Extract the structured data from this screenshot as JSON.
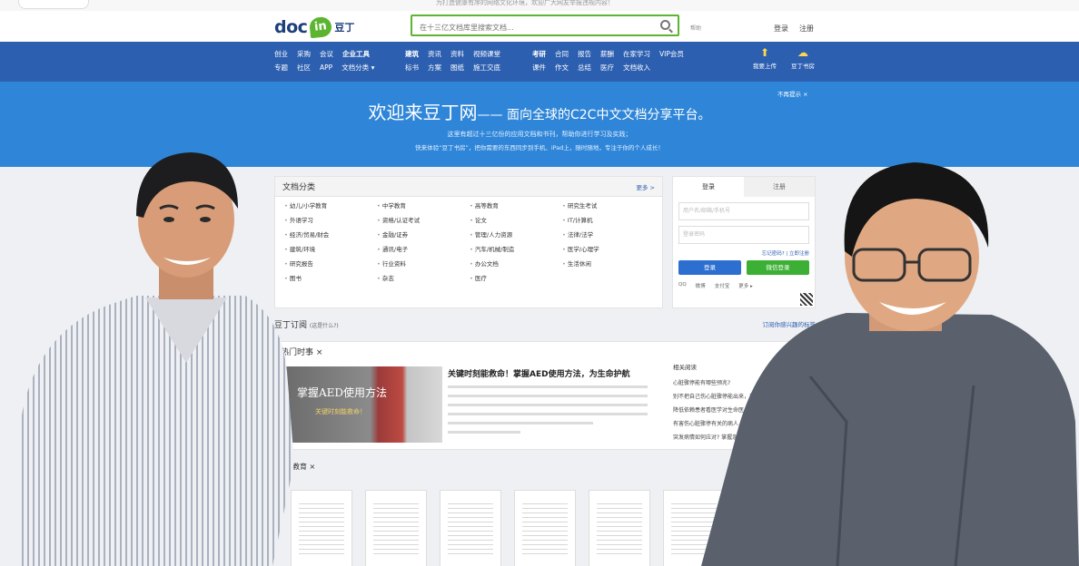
{
  "top_notice": "为打造健康有序的网络文化环境，欢迎广大网友举报违规内容！",
  "header": {
    "logo_doc": "doc",
    "logo_in": "in",
    "logo_cn": "豆丁",
    "search_placeholder": "在十三亿文档库里搜索文档...",
    "help": "帮助",
    "login": "登录",
    "register": "注册"
  },
  "nav": {
    "group1": [
      [
        "创业",
        "采购",
        "会议",
        "企业工具"
      ],
      [
        "专题",
        "社区",
        "APP",
        "文档分类 ▾"
      ]
    ],
    "group2": [
      [
        "建筑",
        "资讯",
        "资料",
        "视频课堂"
      ],
      [
        "标书",
        "方案",
        "图纸",
        "施工交底"
      ]
    ],
    "group3": [
      [
        "考研",
        "合同",
        "报告",
        "薪酬",
        "在家学习",
        "VIP会员"
      ],
      [
        "课件",
        "作文",
        "总结",
        "医疗",
        "文档收入"
      ]
    ],
    "upload": "我要上传",
    "cloud": "豆丁书房"
  },
  "banner": {
    "title": "欢迎来豆丁网",
    "subtitle": "—— 面向全球的C2C中文文档分享平台。",
    "line2": "这里有超过十三亿份的应用文档和书刊，帮助你进行学习及实践；",
    "line3": "快来体验“豆丁书房”，把你需要的东西同步到手机、iPad上，随时随地，专注于你的个人成长！",
    "close": "不再提示 ×"
  },
  "categories": {
    "title": "文档分类",
    "more": "更多 >",
    "items": [
      "幼儿/小学教育",
      "中学教育",
      "高等教育",
      "研究生考试",
      "外语学习",
      "资格/认证考试",
      "论文",
      "IT/计算机",
      "经济/贸易/财会",
      "金融/证券",
      "管理/人力资源",
      "法律/法学",
      "建筑/环境",
      "通讯/电子",
      "汽车/机械/制造",
      "医学/心理学",
      "研究报告",
      "行业资料",
      "办公文档",
      "生活休闲",
      "图书",
      "杂志",
      "医疗"
    ]
  },
  "login_box": {
    "tab_login": "登录",
    "tab_register": "注册",
    "user_placeholder": "用户名/邮箱/手机号",
    "pass_placeholder": "登录密码",
    "forgot": "忘记密码? | 立即注册",
    "btn_login": "登录",
    "btn_wechat": "微信登录",
    "socials": [
      "QQ",
      "微博",
      "支付宝",
      "更多 ▸"
    ]
  },
  "subscribe": {
    "title": "豆丁订阅",
    "hint": "(这是什么?)",
    "action": "订阅你感兴趣的标签"
  },
  "hot": {
    "tab": "热门时事 ×",
    "image_text_1": "掌握AED使用方法",
    "image_text_2": "关键时刻能救命！",
    "headline": "关键时刻能救命！掌握AED使用方法，为生命护航",
    "related_title": "相关阅读",
    "related": [
      "心脏骤停能有哪些预兆?",
      "别不把自己伤心脏骤停能出来，该如何做?",
      "降低依赖患者看医学对生命医心脏骤停有效的方法",
      "有害伤心脏骤停有关的病人，可以服用中草药",
      "突发病情如何应对? 掌握急救知识"
    ]
  },
  "edu": {
    "tab": "学教育 ×"
  }
}
